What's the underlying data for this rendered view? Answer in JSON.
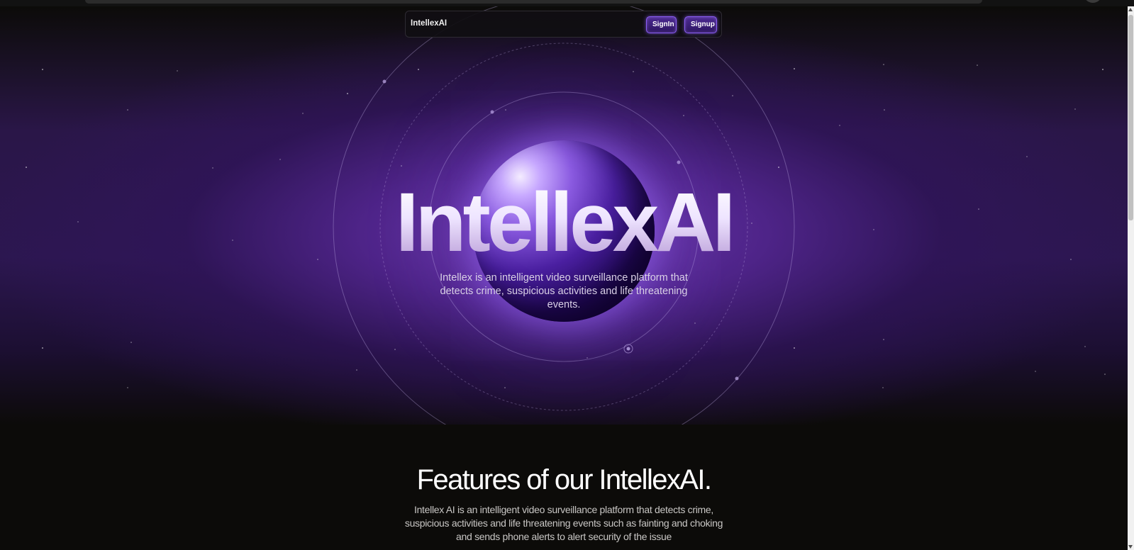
{
  "navbar": {
    "brand": "IntellexAI",
    "signin_label": "SignIn",
    "signup_label": "Signup"
  },
  "hero": {
    "title": "IntellexAI",
    "subtitle": "Intellex is an intelligent video surveillance platform that detects crime, suspicious activities and life threatening events."
  },
  "features": {
    "title": "Features of our IntellexAI.",
    "description": "Intellex AI is an intelligent video surveillance platform that detects crime, suspicious activities and life threatening events such as fainting and choking and sends phone alerts to alert security of the issue"
  },
  "colors": {
    "page_background": "#0c0b09",
    "accent_purple": "#8b5cf6",
    "hero_glow": "#703cb2",
    "sphere_core": "#14053d"
  }
}
